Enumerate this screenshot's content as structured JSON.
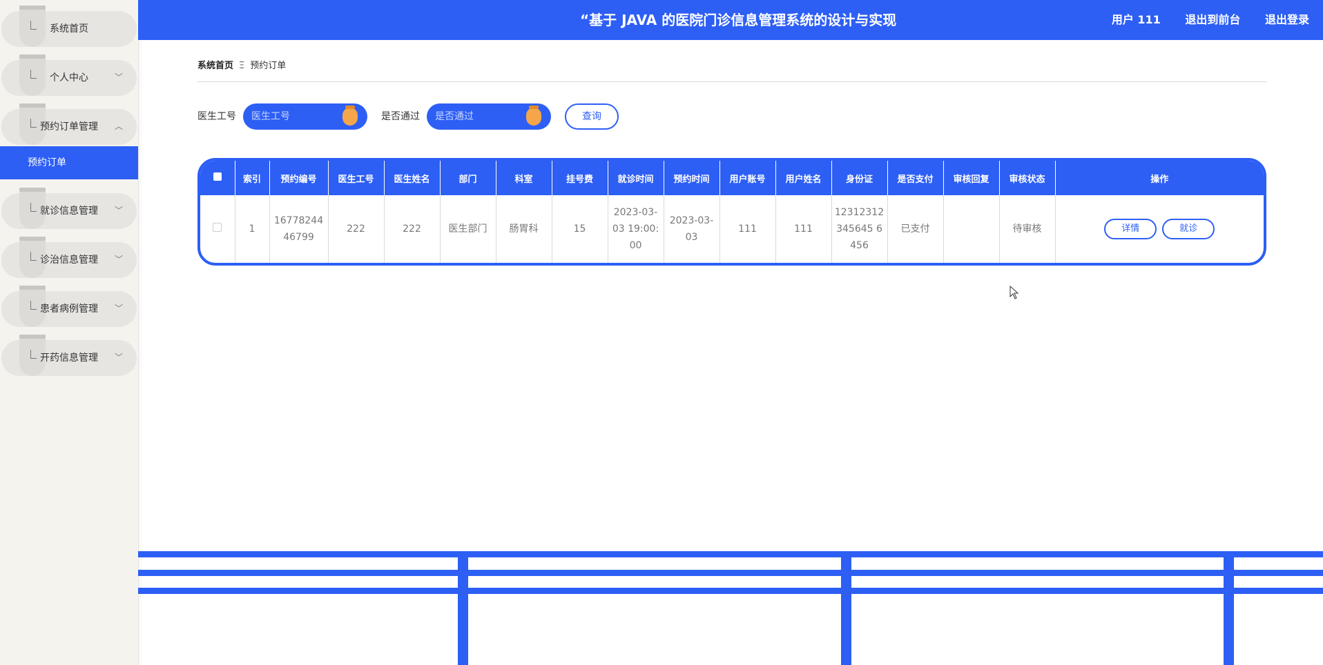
{
  "app": {
    "title": "“基于 JAVA 的医院门诊信息管理系统的设计与实现",
    "user_label": "用户 111",
    "front_link": "退出到前台",
    "logout_link": "退出登录"
  },
  "sidebar": {
    "items": [
      {
        "label": "系统首页",
        "arrow": ""
      },
      {
        "label": "个人中心",
        "arrow": "﹀"
      },
      {
        "label": "预约订单管理",
        "arrow": "︿"
      },
      {
        "label": "就诊信息管理",
        "arrow": "﹀"
      },
      {
        "label": "诊治信息管理",
        "arrow": "﹀"
      },
      {
        "label": "患者病例管理",
        "arrow": "﹀"
      },
      {
        "label": "开药信息管理",
        "arrow": "﹀"
      }
    ],
    "active_sub": "预约订单"
  },
  "breadcrumb": {
    "home": "系统首页",
    "separator": "Ξ",
    "current": "预约订单"
  },
  "search": {
    "doctor_id_label": "医生工号",
    "doctor_id_placeholder": "医生工号",
    "approved_label": "是否通过",
    "approved_placeholder": "是否通过",
    "query_button": "查询"
  },
  "table": {
    "headers": [
      "",
      "索引",
      "预约编号",
      "医生工号",
      "医生姓名",
      "部门",
      "科室",
      "挂号费",
      "就诊时间",
      "预约时间",
      "用户账号",
      "用户姓名",
      "身份证",
      "是否支付",
      "审核回复",
      "审核状态",
      "操作"
    ],
    "rows": [
      {
        "index": "1",
        "order_no": "1677824446799",
        "doctor_id": "222",
        "doctor_name": "222",
        "department": "医生部门",
        "section": "肠胃科",
        "fee": "15",
        "visit_time": "2023-03-03 19:00:00",
        "booking_time": "2023-03-03",
        "user_account": "111",
        "user_name": "111",
        "id_card": "12312312345645 6456",
        "paid": "已支付",
        "review_reply": "",
        "review_status": "待审核",
        "detail_button": "详情",
        "visit_button": "就诊"
      }
    ]
  },
  "colors": {
    "primary": "#2d5ff5",
    "knob": "#f5a64a",
    "sidebar_bg": "#f4f3ee"
  }
}
